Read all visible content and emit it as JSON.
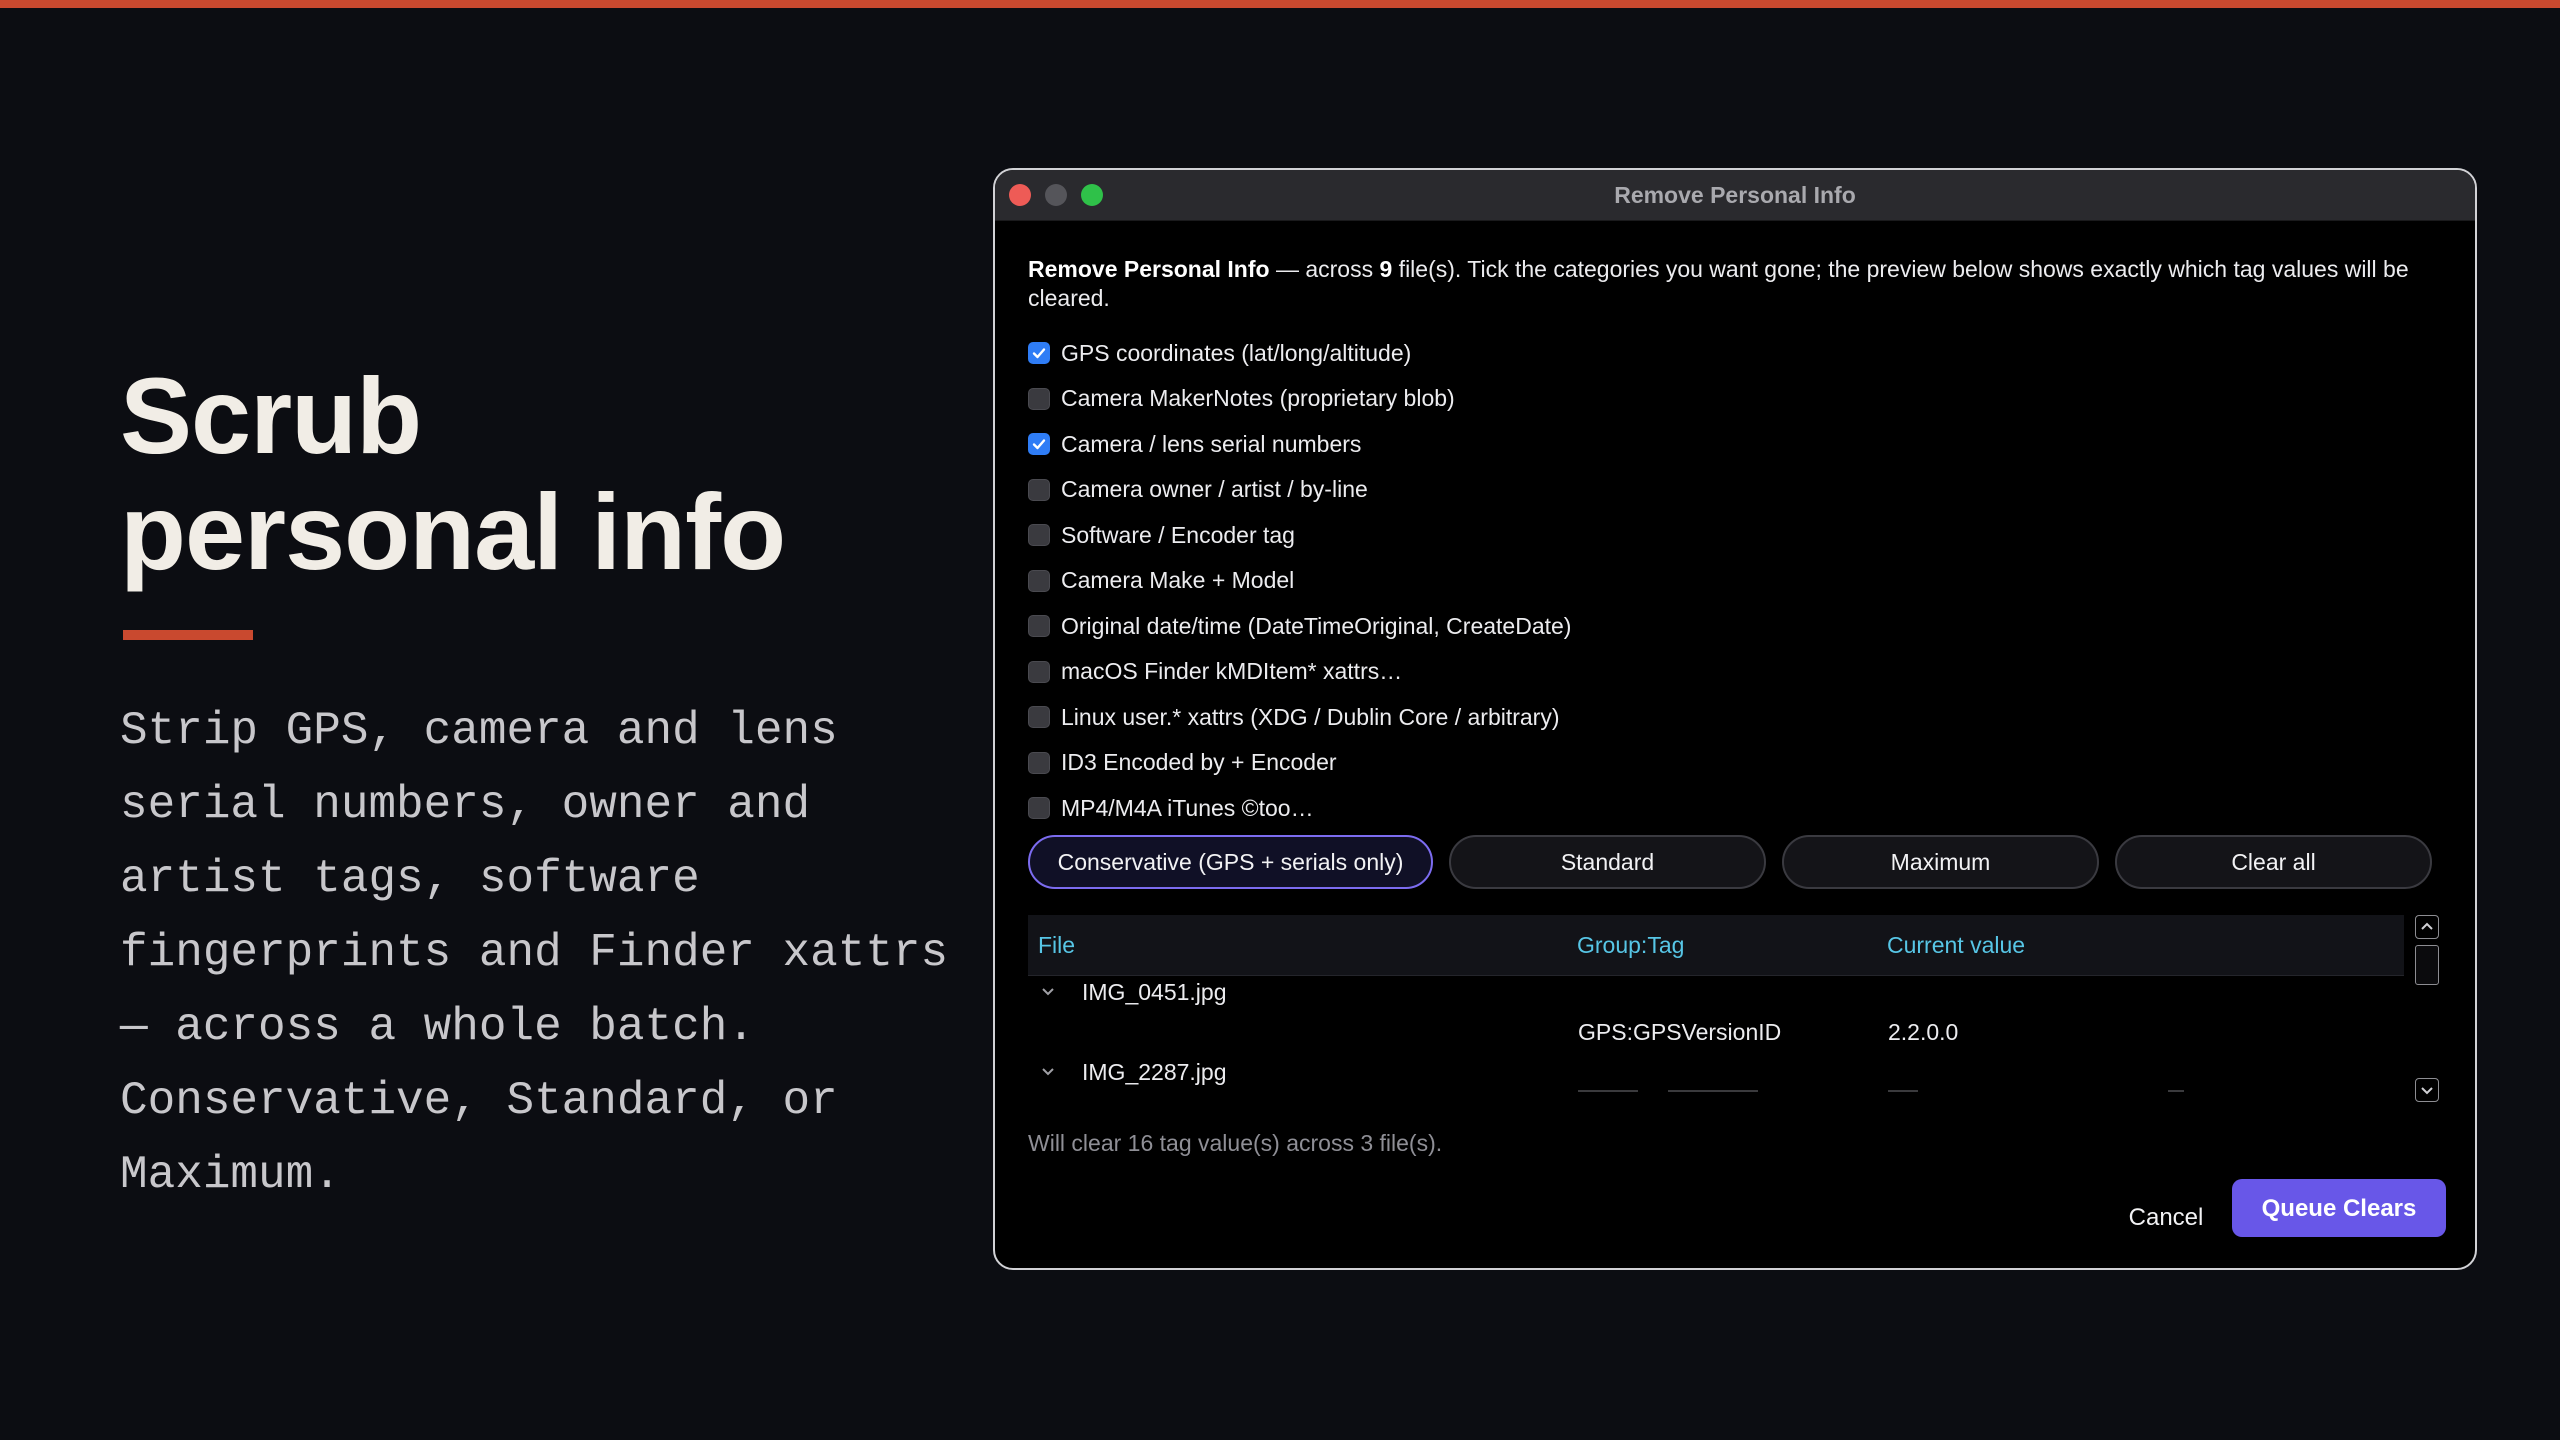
{
  "colors": {
    "accent_bar": "#c9492f",
    "checkbox_on": "#2f7df6",
    "primary_button": "#6857e8",
    "table_header_text": "#57c6e6"
  },
  "hero": {
    "title_line1": "Scrub",
    "title_line2": "personal info",
    "body": "Strip GPS, camera and lens serial numbers, owner and artist tags, software fingerprints and Finder xattrs — across a whole batch. Conservative, Standard, or Maximum."
  },
  "window": {
    "title": "Remove Personal Info",
    "intro": {
      "bold": "Remove Personal Info",
      "pre_count": " — across ",
      "count": "9",
      "post_count": " file(s). Tick the categories you want gone; the preview below shows exactly which tag values will be cleared."
    },
    "categories": [
      {
        "label": "GPS coordinates (lat/long/altitude)",
        "checked": true
      },
      {
        "label": "Camera MakerNotes (proprietary blob)",
        "checked": false
      },
      {
        "label": "Camera / lens serial numbers",
        "checked": true
      },
      {
        "label": "Camera owner / artist / by-line",
        "checked": false
      },
      {
        "label": "Software / Encoder tag",
        "checked": false
      },
      {
        "label": "Camera Make + Model",
        "checked": false
      },
      {
        "label": "Original date/time (DateTimeOriginal, CreateDate)",
        "checked": false
      },
      {
        "label": "macOS Finder kMDItem* xattrs…",
        "checked": false
      },
      {
        "label": "Linux user.* xattrs (XDG / Dublin Core / arbitrary)",
        "checked": false
      },
      {
        "label": "ID3 Encoded by + Encoder",
        "checked": false
      },
      {
        "label": "MP4/M4A iTunes ©too…",
        "checked": false
      }
    ],
    "presets": [
      {
        "label": "Conservative (GPS + serials only)",
        "active": true
      },
      {
        "label": "Standard",
        "active": false
      },
      {
        "label": "Maximum",
        "active": false
      },
      {
        "label": "Clear all",
        "active": false
      }
    ],
    "table": {
      "headers": [
        "File",
        "Group:Tag",
        "Current value"
      ],
      "files": [
        {
          "name": "IMG_0451.jpg",
          "expanded": true,
          "tags": [
            {
              "tag": "GPS:GPSVersionID",
              "value": "2.2.0.0"
            }
          ]
        },
        {
          "name": "IMG_2287.jpg",
          "expanded": true,
          "tags": []
        }
      ]
    },
    "summary": "Will clear 16 tag value(s) across 3 file(s).",
    "cancel_label": "Cancel",
    "primary_label": "Queue Clears"
  }
}
